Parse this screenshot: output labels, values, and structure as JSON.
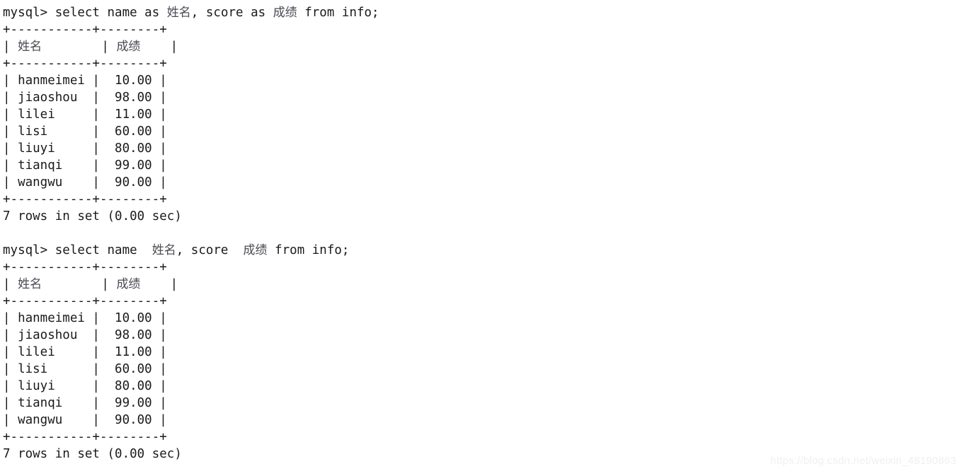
{
  "terminal": {
    "background_color": "#ffffff",
    "text_color": "#1a1a1a",
    "cjk_text_color": "#4a4a52",
    "prompt": "mysql> ",
    "blocks": [
      {
        "query_prefix": "mysql> select name as ",
        "query_alias_1": "姓名",
        "query_mid": ", score as ",
        "query_alias_2": "成绩",
        "query_suffix": " from info;",
        "rule_top": "+-----------+--------+",
        "header_pipe_1": "| ",
        "header_col_1": "姓名",
        "header_gap_1": "        | ",
        "header_col_2": "成绩",
        "header_gap_2": "    |",
        "rule_mid": "+-----------+--------+",
        "rows": [
          "| hanmeimei |  10.00 |",
          "| jiaoshou  |  98.00 |",
          "| lilei     |  11.00 |",
          "| lisi      |  60.00 |",
          "| liuyi     |  80.00 |",
          "| tianqi    |  99.00 |",
          "| wangwu    |  90.00 |"
        ],
        "rule_bottom": "+-----------+--------+",
        "status": "7 rows in set (0.00 sec)"
      },
      {
        "query_prefix": "mysql> select name  ",
        "query_alias_1": "姓名",
        "query_mid": ", score  ",
        "query_alias_2": "成绩",
        "query_suffix": " from info;",
        "rule_top": "+-----------+--------+",
        "header_pipe_1": "| ",
        "header_col_1": "姓名",
        "header_gap_1": "        | ",
        "header_col_2": "成绩",
        "header_gap_2": "    |",
        "rule_mid": "+-----------+--------+",
        "rows": [
          "| hanmeimei |  10.00 |",
          "| jiaoshou  |  98.00 |",
          "| lilei     |  11.00 |",
          "| lisi      |  60.00 |",
          "| liuyi     |  80.00 |",
          "| tianqi    |  99.00 |",
          "| wangwu    |  90.00 |"
        ],
        "rule_bottom": "+-----------+--------+",
        "status": "7 rows in set (0.00 sec)"
      }
    ]
  },
  "watermark": {
    "text": "https://blog.csdn.net/weixin_48190863"
  }
}
